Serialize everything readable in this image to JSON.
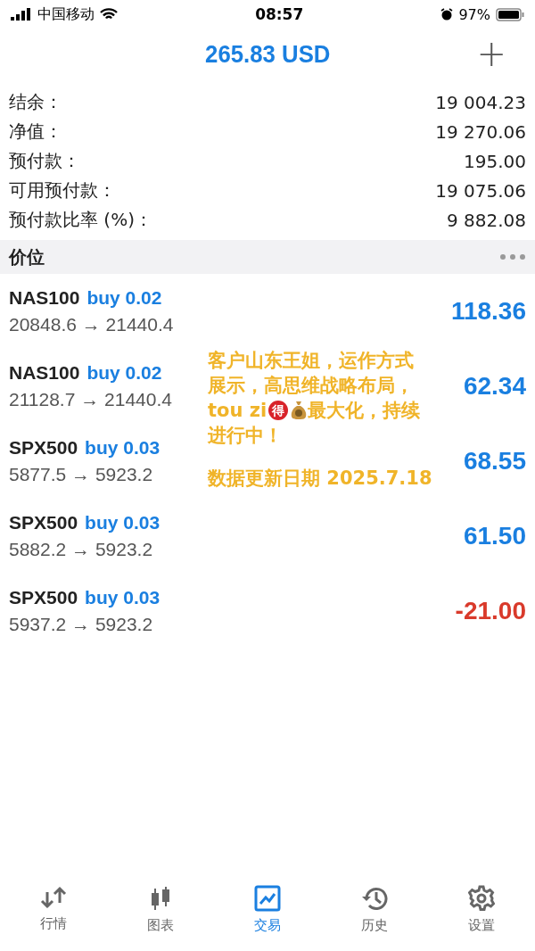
{
  "status_bar": {
    "carrier": "中国移动",
    "time": "08:57",
    "battery": "97%"
  },
  "header": {
    "title": "265.83 USD",
    "add": "+"
  },
  "summary": [
    {
      "label": "结余：",
      "value": "19 004.23"
    },
    {
      "label": "净值：",
      "value": "19 270.06"
    },
    {
      "label": "预付款：",
      "value": "195.00"
    },
    {
      "label": "可用预付款：",
      "value": "19 075.06"
    },
    {
      "label": "预付款比率 (%)：",
      "value": "9 882.08"
    }
  ],
  "section": {
    "title": "价位"
  },
  "positions": [
    {
      "symbol": "NAS100",
      "side": "buy 0.02",
      "prices": "20848.6 → 21440.4",
      "profit": "118.36",
      "loss": false
    },
    {
      "symbol": "NAS100",
      "side": "buy 0.02",
      "prices": "21128.7 → 21440.4",
      "profit": "62.34",
      "loss": false
    },
    {
      "symbol": "SPX500",
      "side": "buy 0.03",
      "prices": "5877.5 → 5923.2",
      "profit": "68.55",
      "loss": false
    },
    {
      "symbol": "SPX500",
      "side": "buy 0.03",
      "prices": "5882.2 → 5923.2",
      "profit": "61.50",
      "loss": false
    },
    {
      "symbol": "SPX500",
      "side": "buy 0.03",
      "prices": "5937.2 → 5923.2",
      "profit": "-21.00",
      "loss": true
    }
  ],
  "overlay_note": {
    "lines": [
      [
        {
          "kind": "text",
          "text": "客户山东王姐，运作方式"
        }
      ],
      [
        {
          "kind": "text",
          "text": "展示，高思维战略布局，"
        }
      ],
      [
        {
          "kind": "text",
          "text": "tou zi"
        },
        {
          "kind": "badge",
          "text": "得"
        },
        {
          "kind": "bag"
        },
        {
          "kind": "text",
          "text": "最大化，持续"
        }
      ],
      [
        {
          "kind": "text",
          "text": "进行中！"
        }
      ]
    ],
    "date": "数据更新日期 2025.7.18"
  },
  "tabs": [
    {
      "label": "行情",
      "kind": "quotes",
      "selected": false
    },
    {
      "label": "图表",
      "kind": "chart",
      "selected": false
    },
    {
      "label": "交易",
      "kind": "trade",
      "selected": true
    },
    {
      "label": "历史",
      "kind": "history",
      "selected": false
    },
    {
      "label": "设置",
      "kind": "settings",
      "selected": false
    }
  ]
}
